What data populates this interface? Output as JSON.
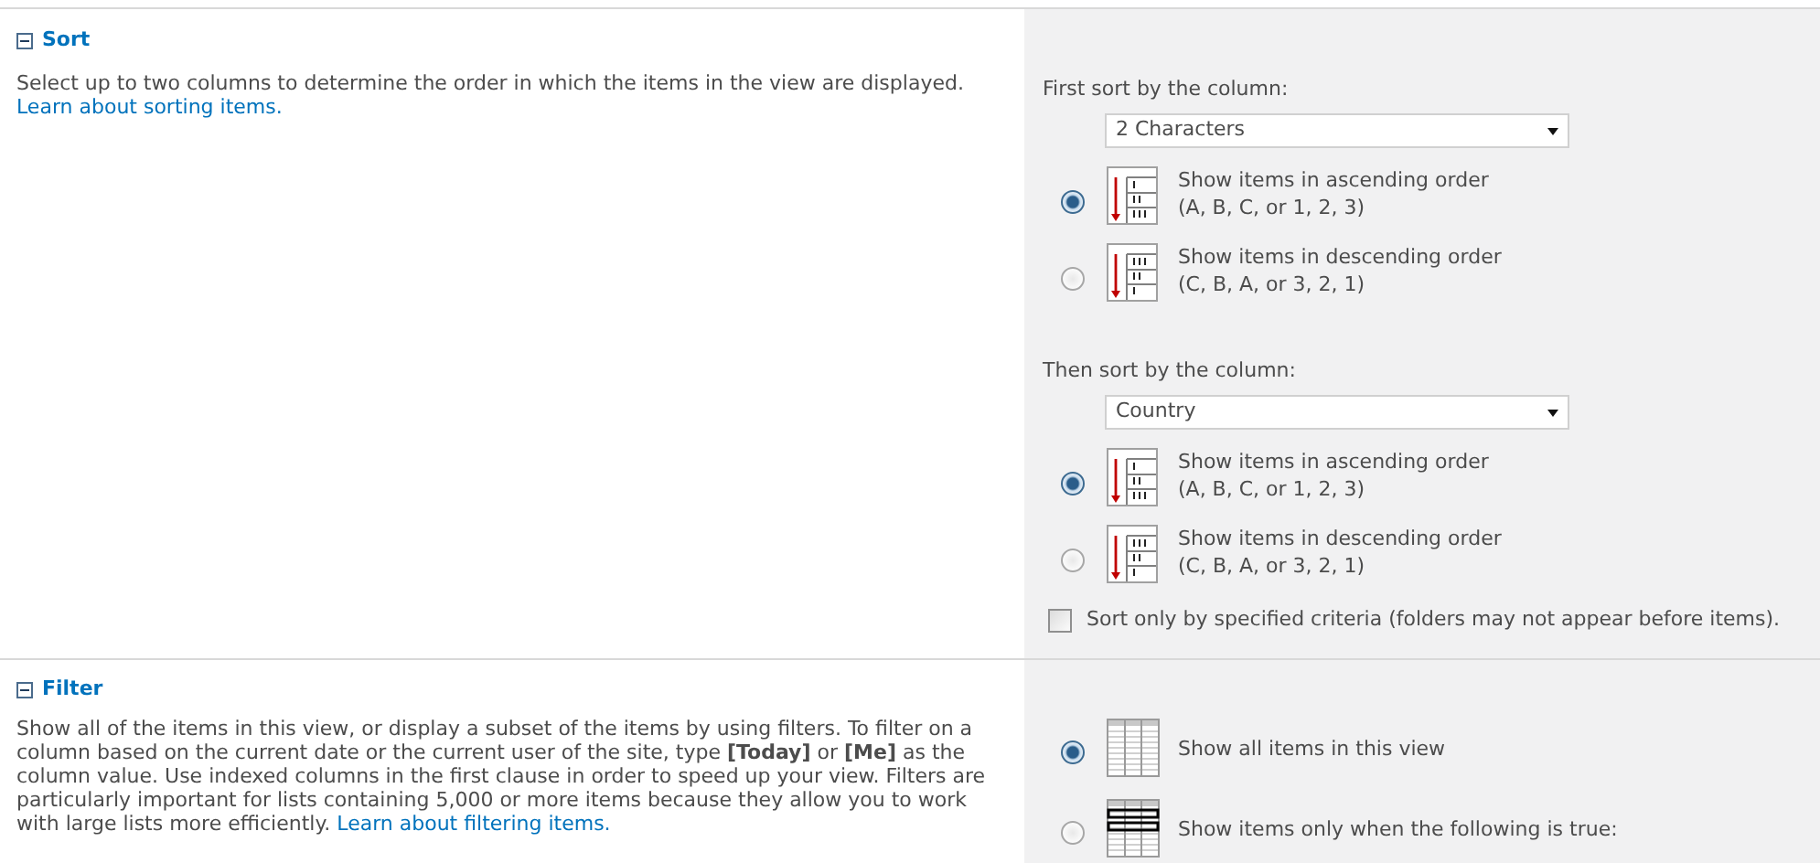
{
  "sort": {
    "title": "Sort",
    "expanded": true,
    "description": "Select up to two columns to determine the order in which the items in the view are displayed.",
    "link": "Learn about sorting items.",
    "groups": [
      {
        "label": "First sort by the column:",
        "value": "2 Characters",
        "options": [
          {
            "kind": "ascending",
            "label": "Show items in ascending order",
            "hint": "(A, B, C, or 1, 2, 3)",
            "selected": true
          },
          {
            "kind": "descending",
            "label": "Show items in descending order",
            "hint": "(C, B, A, or 3, 2, 1)",
            "selected": false
          }
        ]
      },
      {
        "label": "Then sort by the column:",
        "value": "Country",
        "options": [
          {
            "kind": "ascending",
            "label": "Show items in ascending order",
            "hint": "(A, B, C, or 1, 2, 3)",
            "selected": true
          },
          {
            "kind": "descending",
            "label": "Show items in descending order",
            "hint": "(C, B, A, or 3, 2, 1)",
            "selected": false
          }
        ]
      }
    ],
    "only_specified": {
      "label": "Sort only by specified criteria (folders may not appear before items).",
      "checked": false
    }
  },
  "filter": {
    "title": "Filter",
    "expanded": true,
    "description": "Show all of the items in this view, or display a subset of the items by using filters. To filter on a column based on the current date or the current user of the site, type **[Today]** or **[Me]** as the column value. Use indexed columns in the first clause in order to speed up your view. Filters are particularly important for lists containing 5,000 or more items because they allow you to work with large lists more efficiently.",
    "link": "Learn about filtering items.",
    "options": [
      {
        "kind": "all",
        "label": "Show all items in this view",
        "selected": true
      },
      {
        "kind": "conditional",
        "label": "Show items only when the following is true:",
        "selected": false
      }
    ]
  }
}
